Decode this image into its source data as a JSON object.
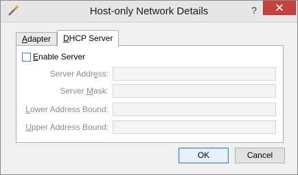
{
  "window": {
    "title": "Host-only Network Details"
  },
  "titlebar": {
    "help_label": "?",
    "icon": "wrench-screwdriver-icon",
    "close_icon": "close-icon"
  },
  "tabs": [
    {
      "label_pre": "",
      "label_u": "A",
      "label_post": "dapter",
      "active": false
    },
    {
      "label_pre": "",
      "label_u": "D",
      "label_post": "HCP Server",
      "active": true
    }
  ],
  "dhcp": {
    "enable": {
      "label_pre": "",
      "label_u": "E",
      "label_post": "nable Server",
      "checked": false
    },
    "fields": [
      {
        "label_pre": "Server Addr",
        "label_u": "e",
        "label_post": "ss:",
        "value": ""
      },
      {
        "label_pre": "Server ",
        "label_u": "M",
        "label_post": "ask:",
        "value": ""
      },
      {
        "label_pre": "",
        "label_u": "L",
        "label_post": "ower Address Bound:",
        "value": ""
      },
      {
        "label_pre": "",
        "label_u": "U",
        "label_post": "pper Address Bound:",
        "value": ""
      }
    ]
  },
  "buttons": {
    "ok": "OK",
    "cancel": "Cancel"
  },
  "colors": {
    "close_bg": "#c7403a",
    "accent": "#3c7fb1"
  }
}
